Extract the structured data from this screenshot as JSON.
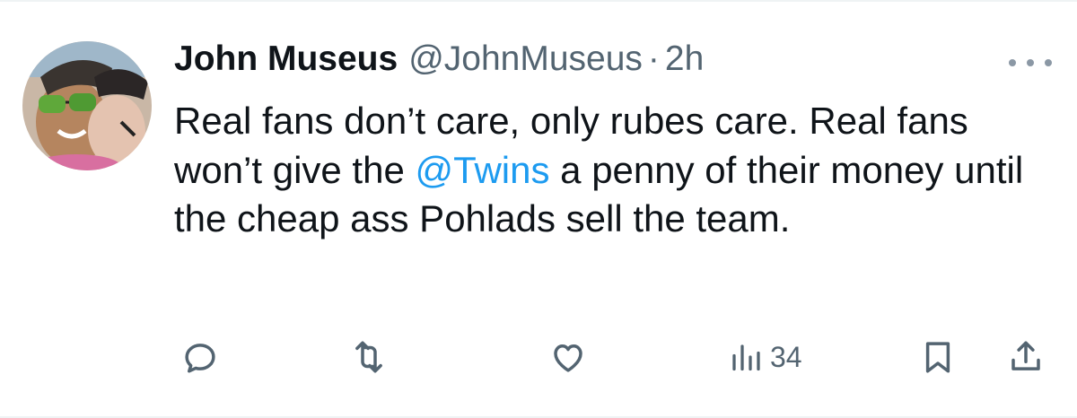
{
  "tweet": {
    "author_name": "John Museus",
    "handle": "@JohnMuseus",
    "separator": "·",
    "time": "2h",
    "text_before": "Real fans don’t care, only rubes care. Real fans won’t give the ",
    "mention": "@Twins",
    "text_after": " a penny of their money until the cheap ass Pohlads sell the team.",
    "mention_color": "#1d9bf0"
  },
  "actions": {
    "reply_icon": "reply-icon",
    "retweet_icon": "retweet-icon",
    "like_icon": "heart-icon",
    "views_icon": "views-icon",
    "views_count": "34",
    "bookmark_icon": "bookmark-icon",
    "share_icon": "share-icon"
  },
  "colors": {
    "text": "#0f1419",
    "secondary": "#536471",
    "icon": "#536471",
    "link": "#1d9bf0"
  }
}
